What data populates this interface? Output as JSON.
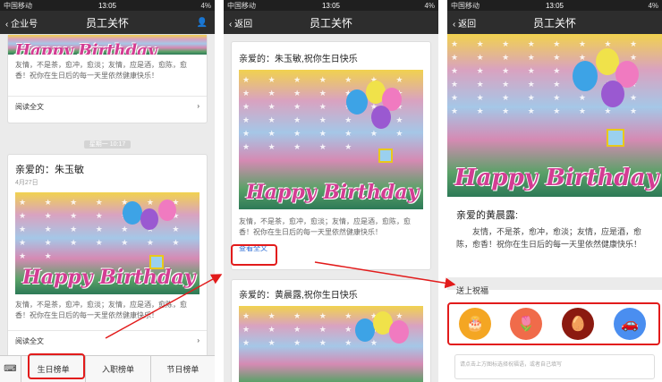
{
  "status": {
    "carrier": "中国移动",
    "time": "13:05",
    "battery": "4%"
  },
  "panel1": {
    "nav_left": "企业号",
    "nav_title": "员工关怀",
    "card1_text": "友情，不是茶，愈冲，愈淡；友情，应是酒，愈陈，愈香！祝你在生日后的每一天里依然健康快乐！",
    "card1_read": "阅读全文",
    "time_sep": "星期一 10:17",
    "card2_title": "亲爱的：朱玉敏",
    "card2_date": "4月27日",
    "card2_text": "友情，不是茶，愈冲，愈淡；友情，应是酒，愈陈，愈香！祝你在生日后的每一天里依然健康快乐！",
    "card2_read": "阅读全文",
    "tabs": [
      "生日榜单",
      "入职榜单",
      "节日榜单"
    ]
  },
  "panel2": {
    "nav_back": "返回",
    "nav_title": "员工关怀",
    "card1_title": "亲爱的：朱玉敏,祝你生日快乐",
    "card1_text": "友情，不是茶，愈冲，愈淡；友情，应是酒，愈陈，愈香！祝你在生日后的每一天里依然健康快乐！",
    "view_all": "查看全文",
    "card2_title": "亲爱的：黄晨露,祝你生日快乐"
  },
  "panel3": {
    "nav_back": "返回",
    "nav_title": "员工关怀",
    "greeting": "亲爱的黄晨露:",
    "body": "友情，不是茶，愈冲，愈淡；友情，应是酒，愈陈，愈香！祝你在生日后的每一天里依然健康快乐！",
    "send_label": "送上祝福",
    "input_placeholder": "请点击上方图标选择祝福语，或者自己填写"
  },
  "image_text": "Happy Birthday",
  "colors": {
    "highlight": "#e21b1b",
    "cake": "#f4a623",
    "tulip": "#f06b4a",
    "egg": "#8b1a10",
    "car": "#4a8ef0"
  }
}
